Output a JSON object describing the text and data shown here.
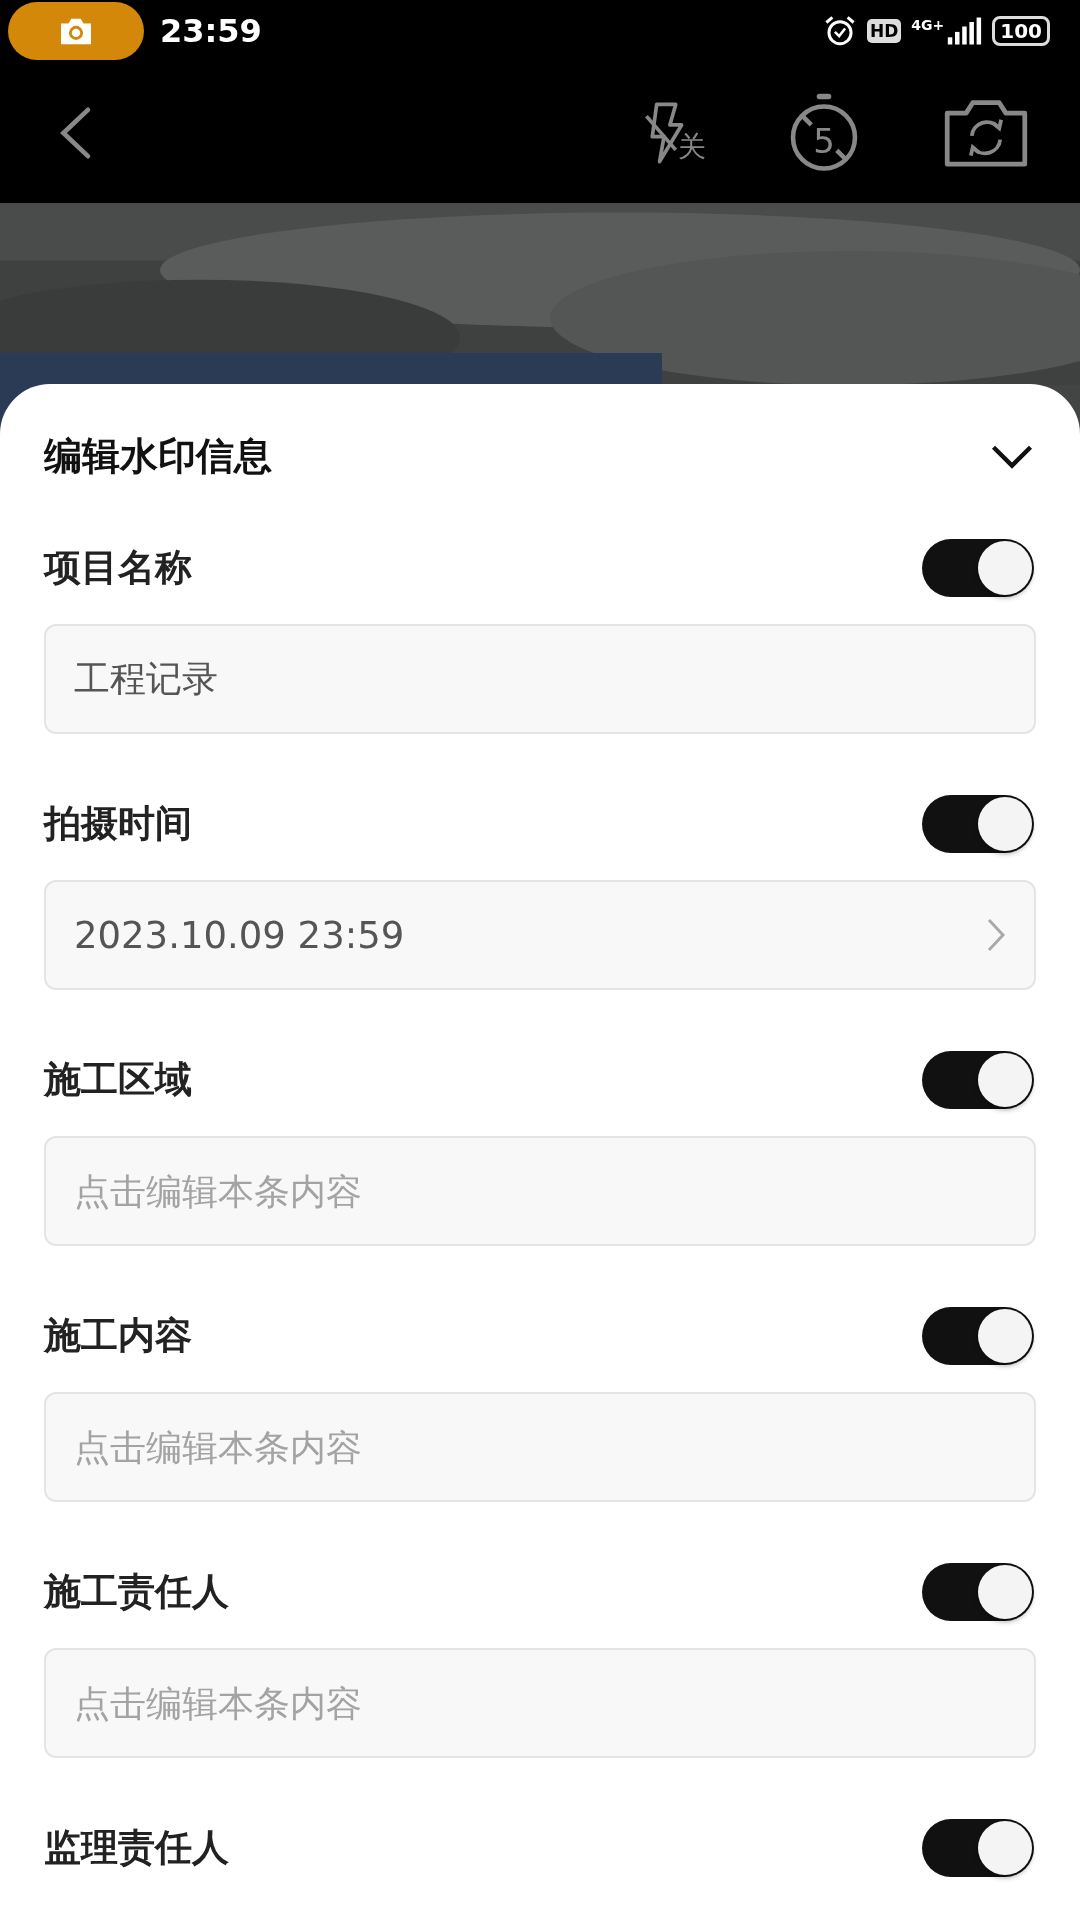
{
  "status_bar": {
    "time": "23:59",
    "network": "4G+",
    "hd": "HD",
    "battery": "100"
  },
  "camera_toolbar": {
    "flash_label": "关",
    "timer_label": "5"
  },
  "sheet": {
    "title": "编辑水印信息",
    "sections": [
      {
        "label": "项目名称",
        "on": true,
        "field": {
          "kind": "text",
          "value": "工程记录"
        }
      },
      {
        "label": "拍摄时间",
        "on": true,
        "field": {
          "kind": "picker",
          "value": "2023.10.09 23:59"
        }
      },
      {
        "label": "施工区域",
        "on": true,
        "field": {
          "kind": "text",
          "placeholder": "点击编辑本条内容"
        }
      },
      {
        "label": "施工内容",
        "on": true,
        "field": {
          "kind": "text",
          "placeholder": "点击编辑本条内容"
        }
      },
      {
        "label": "施工责任人",
        "on": true,
        "field": {
          "kind": "text",
          "placeholder": "点击编辑本条内容"
        }
      },
      {
        "label": "监理责任人",
        "on": true
      }
    ]
  }
}
